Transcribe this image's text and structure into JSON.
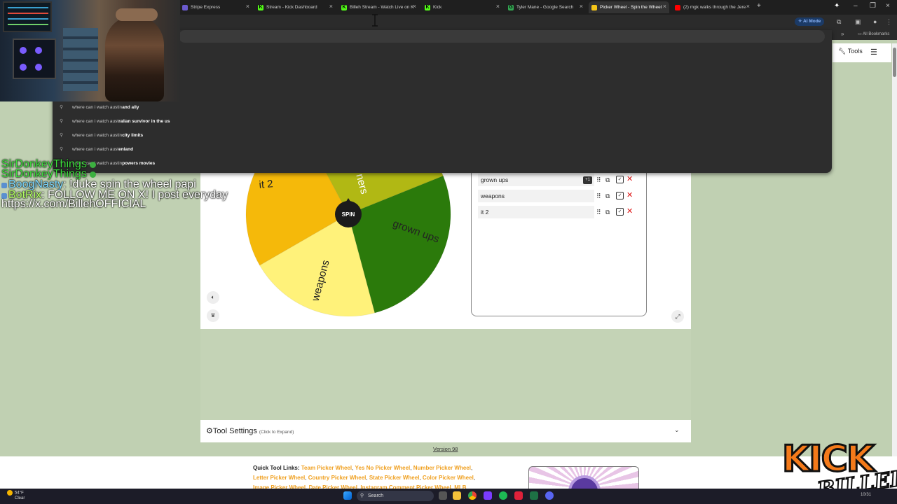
{
  "browser": {
    "tabs": [
      {
        "label": "Stripe Express",
        "fav_color": "#6a5acd",
        "fav_glyph": ""
      },
      {
        "label": "Stream - Kick Dashboard",
        "fav_color": "#53fc18",
        "fav_glyph": "K"
      },
      {
        "label": "Billeh Stream - Watch Live on K",
        "fav_color": "#53fc18",
        "fav_glyph": "K"
      },
      {
        "label": "Kick",
        "fav_color": "#53fc18",
        "fav_glyph": "K"
      },
      {
        "label": "Tyler Mane - Google Search",
        "fav_color": "#34a853",
        "fav_glyph": "G"
      },
      {
        "label": "Picker Wheel - Spin the Wheel",
        "fav_color": "#f5c518",
        "fav_glyph": ""
      },
      {
        "label": "(2) mgk walks through the Jere",
        "fav_color": "#ff0000",
        "fav_glyph": ""
      }
    ],
    "ai_mode_label": "AI Mode",
    "all_bookmarks_label": "All Bookmarks"
  },
  "omnibox": {
    "suggestions": [
      {
        "prefix": "where can i watch austin ",
        "completion": "and ally"
      },
      {
        "prefix": "where can i watch aust",
        "completion": "ralian survivor in the us"
      },
      {
        "prefix": "where can i watch austin ",
        "completion": "city limits"
      },
      {
        "prefix": "where can i watch aust",
        "completion": "enland"
      },
      {
        "prefix": "where can i watch austin ",
        "completion": "powers movies"
      }
    ]
  },
  "page": {
    "tools_label": "Tools",
    "wheel": {
      "spin_label": "SPIN",
      "segments": [
        {
          "label": "it 2",
          "color": "#fff27a"
        },
        {
          "label": "weapons",
          "color": "#f5b90a"
        },
        {
          "label": "grown ups",
          "color": "#b1b814"
        },
        {
          "label": "ners",
          "color": "#2b7a0b"
        }
      ]
    },
    "entries": [
      {
        "text": "grown ups",
        "badge": "+1"
      },
      {
        "text": "weapons",
        "badge": ""
      },
      {
        "text": "it 2",
        "badge": ""
      }
    ],
    "tool_settings": {
      "title": "Tool Settings",
      "hint": "(Click to Expand)"
    },
    "version": "Version 98",
    "quick_links": {
      "label": "Quick Tool Links:",
      "line1": [
        "Team Picker Wheel",
        "Yes No Picker Wheel",
        "Number Picker Wheel"
      ],
      "line2": [
        "Letter Picker Wheel",
        "Country Picker Wheel",
        "State Picker Wheel",
        "Color Picker Wheel"
      ],
      "line3": "Image Picker Wheel, Date Picker Wheel, Instagram Comment Picker Wheel, MLB"
    }
  },
  "chat": [
    {
      "user": "SirDonkeyThings",
      "sep": "",
      "msg": ""
    },
    {
      "user": "SirDonkeyThings",
      "sep": "",
      "msg": ""
    },
    {
      "user": "BoogNasty",
      "sep": ":",
      "msg": "!duke spin the wheel papi"
    },
    {
      "user": "BotRix",
      "sep": ":",
      "msg": "FOLLOW ME ON X! I post everyday"
    },
    {
      "user": "",
      "sep": "",
      "msg": "https://x.com/BillehOFFICIAL"
    }
  ],
  "overlay": {
    "logo_top": "KICK",
    "logo_bottom": "BILLEH"
  },
  "taskbar": {
    "weather_temp": "54°F",
    "weather_desc": "Clear",
    "search_label": "Search",
    "clock": "10/31"
  }
}
